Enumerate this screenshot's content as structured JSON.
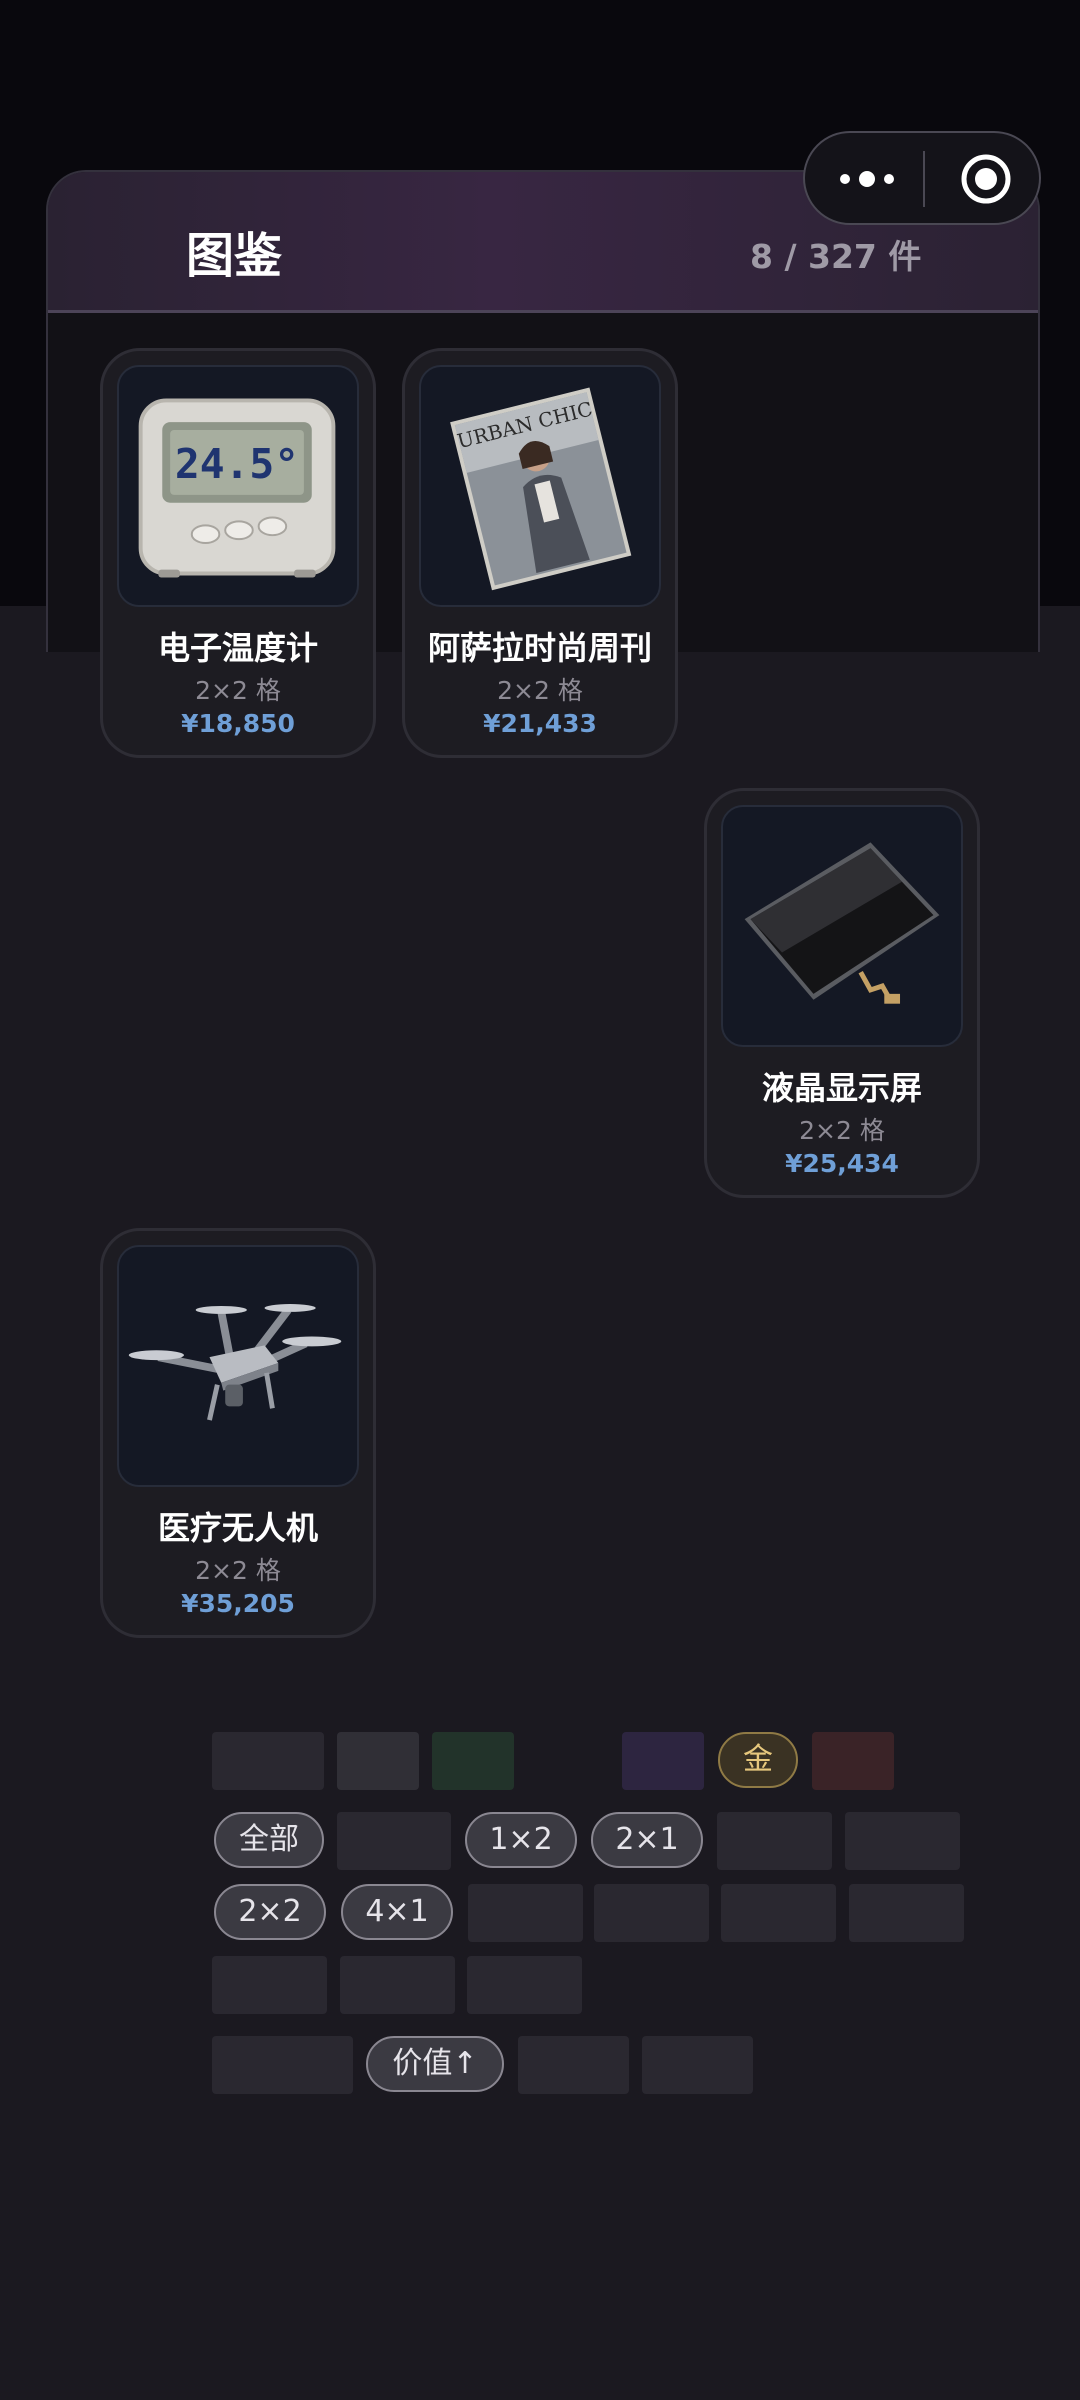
{
  "header": {
    "title": "图鉴",
    "count": "8 / 327 件"
  },
  "capsule": {
    "more_icon": "more-dots-icon",
    "close_icon": "target-icon"
  },
  "items": [
    {
      "name": "电子温度计",
      "size": "2×2 格",
      "price": "¥18,850",
      "image": "digital-thermometer",
      "display": "24.5°"
    },
    {
      "name": "阿萨拉时尚周刊",
      "size": "2×2 格",
      "price": "¥21,433",
      "image": "fashion-magazine",
      "cover_text": "URBAN CHIC"
    },
    {
      "name": "液晶显示屏",
      "size": "2×2 格",
      "price": "¥25,434",
      "image": "lcd-screen"
    },
    {
      "name": "医疗无人机",
      "size": "2×2 格",
      "price": "¥35,205",
      "image": "medical-drone"
    }
  ],
  "filters": {
    "quality": [
      "金"
    ],
    "size": [
      "全部",
      "1×2",
      "2×1",
      "2×2",
      "4×1"
    ],
    "sort": [
      "价值↑"
    ]
  },
  "colors": {
    "accent_price": "#6f9fd7",
    "gold": "#e7c87d",
    "header_purple": "#382642"
  }
}
